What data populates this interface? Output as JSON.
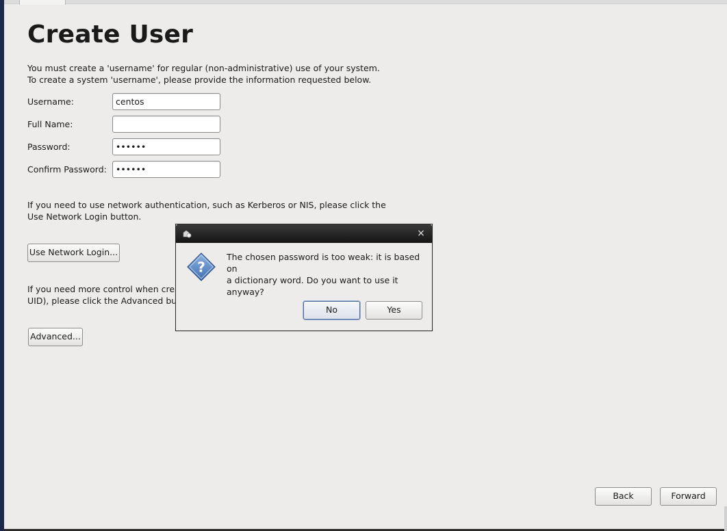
{
  "page": {
    "title": "Create User",
    "intro_text": "You must create a 'username' for regular (non-administrative) use of your system.\nTo create a system 'username', please provide the information requested below.",
    "network_text": "If you need to use network authentication, such as Kerberos or NIS, please click the\nUse Network Login button.",
    "advanced_text": "If you need more control when creatin\nUID), please click the Advanced butt"
  },
  "form": {
    "username_label": "Username:",
    "username_value": "centos",
    "fullname_label": "Full Name:",
    "fullname_value": "",
    "password_label": "Password:",
    "password_value": "••••••",
    "confirm_label": "Confirm Password:",
    "confirm_value": "••••••"
  },
  "buttons": {
    "network_login": "Use Network Login...",
    "advanced": "Advanced...",
    "back": "Back",
    "forward": "Forward"
  },
  "dialog": {
    "close_glyph": "×",
    "message": "The chosen password is too weak: it is based on\na dictionary word. Do you want to use it anyway?",
    "no_label": "No",
    "yes_label": "Yes",
    "icon": "question-icon"
  },
  "colors": {
    "background": "#edecea",
    "titlebar": "#1b1b1b",
    "question_icon_blue": "#3f6fb0",
    "default_button_border": "#4a6a9a"
  }
}
